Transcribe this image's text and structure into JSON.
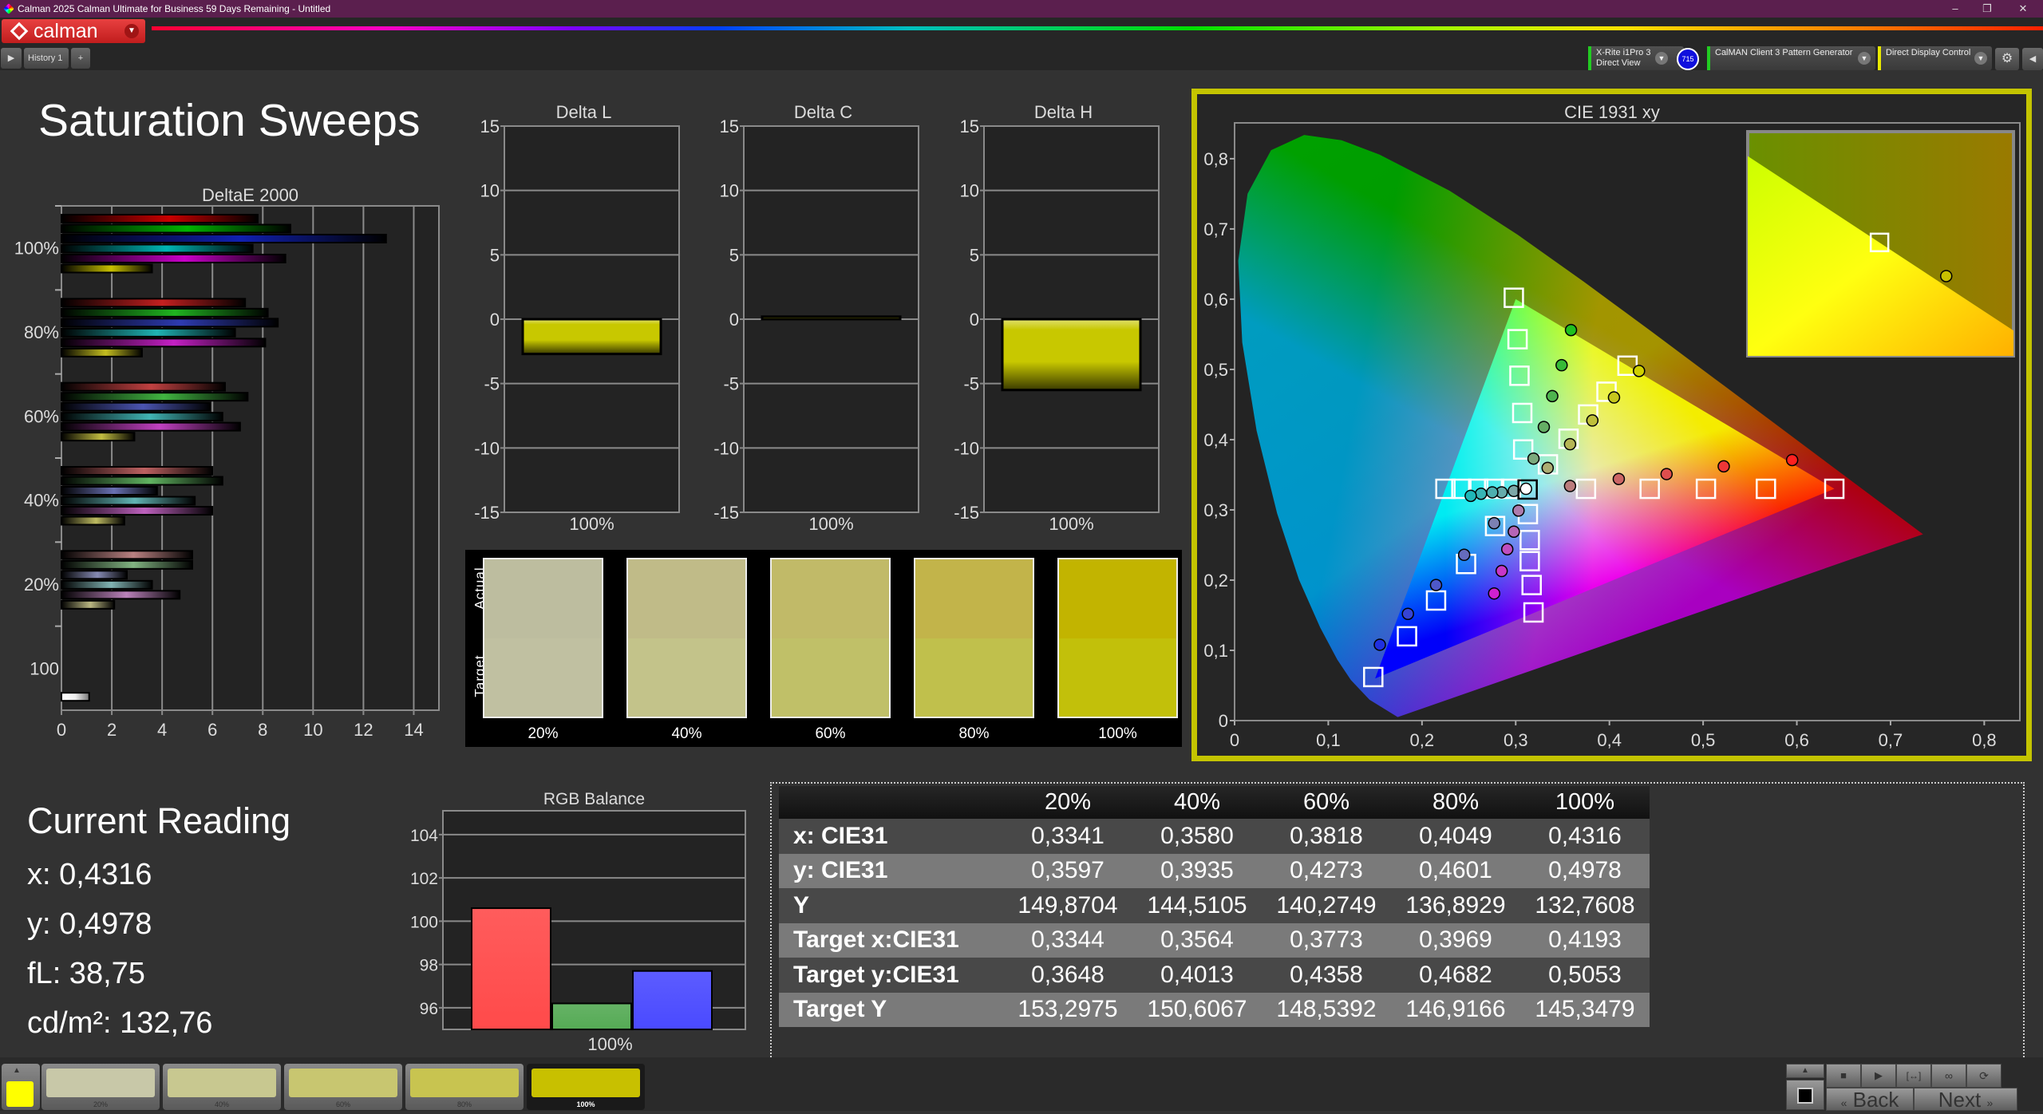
{
  "window": {
    "title": "Calman 2025 Calman Ultimate for Business 59 Days Remaining  - Untitled",
    "controls": [
      "minimize-icon",
      "restore-icon",
      "close-icon"
    ]
  },
  "app": {
    "logo_text": "calman"
  },
  "tabs": [
    {
      "label": "History 1"
    }
  ],
  "devices": [
    {
      "line1": "X-Rite i1Pro 3",
      "line2": "Direct View",
      "accent": "#22cc22",
      "badge": "715"
    },
    {
      "line1": "CalMAN Client 3 Pattern Generator",
      "line2": "",
      "accent": "#22cc22"
    },
    {
      "line1": "Direct Display Control",
      "line2": "",
      "accent": "#e8e800"
    }
  ],
  "page_title": "Saturation Sweeps",
  "chart_data": [
    {
      "type": "bar",
      "orientation": "horizontal",
      "title": "DeltaE 2000",
      "categories": [
        "100%",
        "80%",
        "60%",
        "40%",
        "20%",
        "100"
      ],
      "xlim": [
        0,
        15
      ],
      "xticks": [
        0,
        2,
        4,
        6,
        8,
        10,
        12,
        14
      ],
      "grid": true,
      "series": [
        {
          "color": "#c80000",
          "values": [
            7.8,
            7.3,
            6.5,
            6.0,
            5.2,
            null
          ]
        },
        {
          "color": "#00b400",
          "values": [
            9.1,
            8.2,
            7.4,
            6.4,
            5.2,
            null
          ]
        },
        {
          "color": "#1020b0",
          "values": [
            12.9,
            8.6,
            5.9,
            3.8,
            2.6,
            null
          ]
        },
        {
          "color": "#00b4b4",
          "values": [
            7.6,
            6.9,
            6.4,
            5.3,
            3.6,
            null
          ]
        },
        {
          "color": "#c800c8",
          "values": [
            8.9,
            8.1,
            7.1,
            6.0,
            4.7,
            null
          ]
        },
        {
          "color": "#c8c000",
          "values": [
            3.6,
            3.2,
            2.9,
            2.5,
            2.1,
            null
          ]
        },
        {
          "color": "#ffffff",
          "values": [
            null,
            null,
            null,
            null,
            null,
            1.1
          ]
        }
      ]
    },
    {
      "type": "bar",
      "title": "Delta L",
      "categories": [
        "100%"
      ],
      "values": [
        -2.7
      ],
      "ylim": [
        -15,
        15
      ],
      "yticks": [
        -15,
        -10,
        -5,
        0,
        5,
        10,
        15
      ],
      "color": "#c8c800"
    },
    {
      "type": "bar",
      "title": "Delta C",
      "categories": [
        "100%"
      ],
      "values": [
        0.2
      ],
      "ylim": [
        -15,
        15
      ],
      "yticks": [
        -15,
        -10,
        -5,
        0,
        5,
        10,
        15
      ],
      "color": "#c8c800"
    },
    {
      "type": "bar",
      "title": "Delta H",
      "categories": [
        "100%"
      ],
      "values": [
        -5.5
      ],
      "ylim": [
        -15,
        15
      ],
      "yticks": [
        -15,
        -10,
        -5,
        0,
        5,
        10,
        15
      ],
      "color": "#c8c800"
    },
    {
      "type": "scatter",
      "title": "CIE 1931 xy",
      "xlim": [
        0,
        0.838
      ],
      "ylim": [
        0,
        0.851
      ],
      "xticks": [
        0,
        0.1,
        0.2,
        0.3,
        0.4,
        0.5,
        0.6,
        0.7,
        0.8
      ],
      "xtick_labels": [
        "0",
        "0,1",
        "0,2",
        "0,3",
        "0,4",
        "0,5",
        "0,6",
        "0,7",
        "0,8"
      ],
      "yticks": [
        0,
        0.1,
        0.2,
        0.3,
        0.4,
        0.5,
        0.6,
        0.7,
        0.8
      ],
      "ytick_labels": [
        "0",
        "0,1",
        "0,2",
        "0,3",
        "0,4",
        "0,5",
        "0,6",
        "0,7",
        "0,8"
      ],
      "gamut": {
        "red": [
          0.64,
          0.33
        ],
        "green": [
          0.3,
          0.6
        ],
        "blue": [
          0.15,
          0.06
        ]
      },
      "white_point": {
        "target": [
          0.3127,
          0.329
        ],
        "measured": [
          0.311,
          0.33
        ]
      },
      "series": [
        {
          "color": "#ff2020",
          "targets": [
            [
              0.375,
              0.33
            ],
            [
              0.443,
              0.33
            ],
            [
              0.503,
              0.33
            ],
            [
              0.567,
              0.33
            ],
            [
              0.64,
              0.33
            ]
          ],
          "measured": [
            [
              0.358,
              0.334
            ],
            [
              0.41,
              0.344
            ],
            [
              0.461,
              0.351
            ],
            [
              0.522,
              0.362
            ],
            [
              0.595,
              0.371
            ]
          ]
        },
        {
          "color": "#20c020",
          "targets": [
            [
              0.308,
              0.386
            ],
            [
              0.307,
              0.438
            ],
            [
              0.304,
              0.491
            ],
            [
              0.302,
              0.543
            ],
            [
              0.298,
              0.602
            ]
          ],
          "measured": [
            [
              0.319,
              0.373
            ],
            [
              0.33,
              0.418
            ],
            [
              0.339,
              0.462
            ],
            [
              0.349,
              0.506
            ],
            [
              0.359,
              0.556
            ]
          ]
        },
        {
          "color": "#2030e0",
          "targets": [
            [
              0.278,
              0.277
            ],
            [
              0.247,
              0.223
            ],
            [
              0.215,
              0.171
            ],
            [
              0.184,
              0.12
            ],
            [
              0.148,
              0.062
            ]
          ],
          "measured": [
            [
              0.277,
              0.281
            ],
            [
              0.245,
              0.236
            ],
            [
              0.215,
              0.193
            ],
            [
              0.185,
              0.152
            ],
            [
              0.155,
              0.108
            ]
          ]
        },
        {
          "color": "#20b8b8",
          "targets": [
            [
              0.295,
              0.33
            ],
            [
              0.277,
              0.33
            ],
            [
              0.26,
              0.33
            ],
            [
              0.242,
              0.33
            ],
            [
              0.225,
              0.33
            ]
          ],
          "measured": [
            [
              0.298,
              0.327
            ],
            [
              0.285,
              0.325
            ],
            [
              0.275,
              0.325
            ],
            [
              0.263,
              0.323
            ],
            [
              0.252,
              0.32
            ]
          ]
        },
        {
          "color": "#d020d0",
          "targets": [
            [
              0.313,
              0.294
            ],
            [
              0.315,
              0.257
            ],
            [
              0.315,
              0.227
            ],
            [
              0.317,
              0.193
            ],
            [
              0.319,
              0.154
            ]
          ],
          "measured": [
            [
              0.303,
              0.299
            ],
            [
              0.298,
              0.269
            ],
            [
              0.291,
              0.244
            ],
            [
              0.285,
              0.213
            ],
            [
              0.277,
              0.181
            ]
          ]
        },
        {
          "color": "#d0d000",
          "targets": [
            [
              0.3344,
              0.3648
            ],
            [
              0.3564,
              0.4013
            ],
            [
              0.3773,
              0.4358
            ],
            [
              0.3969,
              0.4682
            ],
            [
              0.4193,
              0.5053
            ]
          ],
          "measured": [
            [
              0.3341,
              0.3597
            ],
            [
              0.358,
              0.3935
            ],
            [
              0.3818,
              0.4273
            ],
            [
              0.4049,
              0.4601
            ],
            [
              0.4316,
              0.4978
            ]
          ]
        }
      ],
      "inset": {
        "xlim": [
          0.395,
          0.444
        ],
        "ylim": [
          0.48,
          0.53
        ],
        "target": [
          0.4193,
          0.5053
        ],
        "measured": [
          0.4316,
          0.4978
        ]
      }
    },
    {
      "type": "bar",
      "title": "RGB Balance",
      "categories": [
        "100%"
      ],
      "ylim": [
        95,
        105.1
      ],
      "yticks": [
        96,
        98,
        100,
        102,
        104
      ],
      "series": [
        {
          "color": "#ff4a4a",
          "values": [
            100.6
          ]
        },
        {
          "color": "#55aa55",
          "values": [
            96.2
          ]
        },
        {
          "color": "#4a4aff",
          "values": [
            97.7
          ]
        }
      ]
    }
  ],
  "swatches": {
    "actual_label": "Actual",
    "target_label": "Target",
    "items": [
      {
        "label": "20%",
        "actual": "#bdbd9f",
        "target": "#c0c0a1"
      },
      {
        "label": "40%",
        "actual": "#c0bb88",
        "target": "#c3c38a"
      },
      {
        "label": "60%",
        "actual": "#c1ba68",
        "target": "#c0c068"
      },
      {
        "label": "80%",
        "actual": "#c2b44a",
        "target": "#c0c04c"
      },
      {
        "label": "100%",
        "actual": "#c2b400",
        "target": "#c2c00a"
      }
    ]
  },
  "current_reading": {
    "title": "Current Reading",
    "x": "x: 0,4316",
    "y": "y: 0,4978",
    "fl": "fL: 38,75",
    "cdm2": "cd/m²: 132,76"
  },
  "table": {
    "columns": [
      "",
      "20%",
      "40%",
      "60%",
      "80%",
      "100%"
    ],
    "rows": [
      {
        "label": "x: CIE31",
        "values": [
          "0,3341",
          "0,3580",
          "0,3818",
          "0,4049",
          "0,4316"
        ]
      },
      {
        "label": "y: CIE31",
        "values": [
          "0,3597",
          "0,3935",
          "0,4273",
          "0,4601",
          "0,4978"
        ]
      },
      {
        "label": "Y",
        "values": [
          "149,8704",
          "144,5105",
          "140,2749",
          "136,8929",
          "132,7608"
        ]
      },
      {
        "label": "Target x:CIE31",
        "values": [
          "0,3344",
          "0,3564",
          "0,3773",
          "0,3969",
          "0,4193"
        ]
      },
      {
        "label": "Target y:CIE31",
        "values": [
          "0,3648",
          "0,4013",
          "0,4358",
          "0,4682",
          "0,5053"
        ]
      },
      {
        "label": "Target Y",
        "values": [
          "153,2975",
          "150,6067",
          "148,5392",
          "146,9166",
          "145,3479"
        ]
      }
    ]
  },
  "bottom_bar": {
    "current_color": "#ffff00",
    "selected": "100%",
    "items": [
      {
        "label": "20%",
        "color": "#c8c8a8"
      },
      {
        "label": "40%",
        "color": "#c8c890"
      },
      {
        "label": "60%",
        "color": "#c8c670"
      },
      {
        "label": "80%",
        "color": "#c8c450"
      },
      {
        "label": "100%",
        "color": "#c8c000"
      }
    ]
  },
  "nav": {
    "back": "Back",
    "next": "Next",
    "back_icon": "«",
    "next_icon": "»"
  }
}
